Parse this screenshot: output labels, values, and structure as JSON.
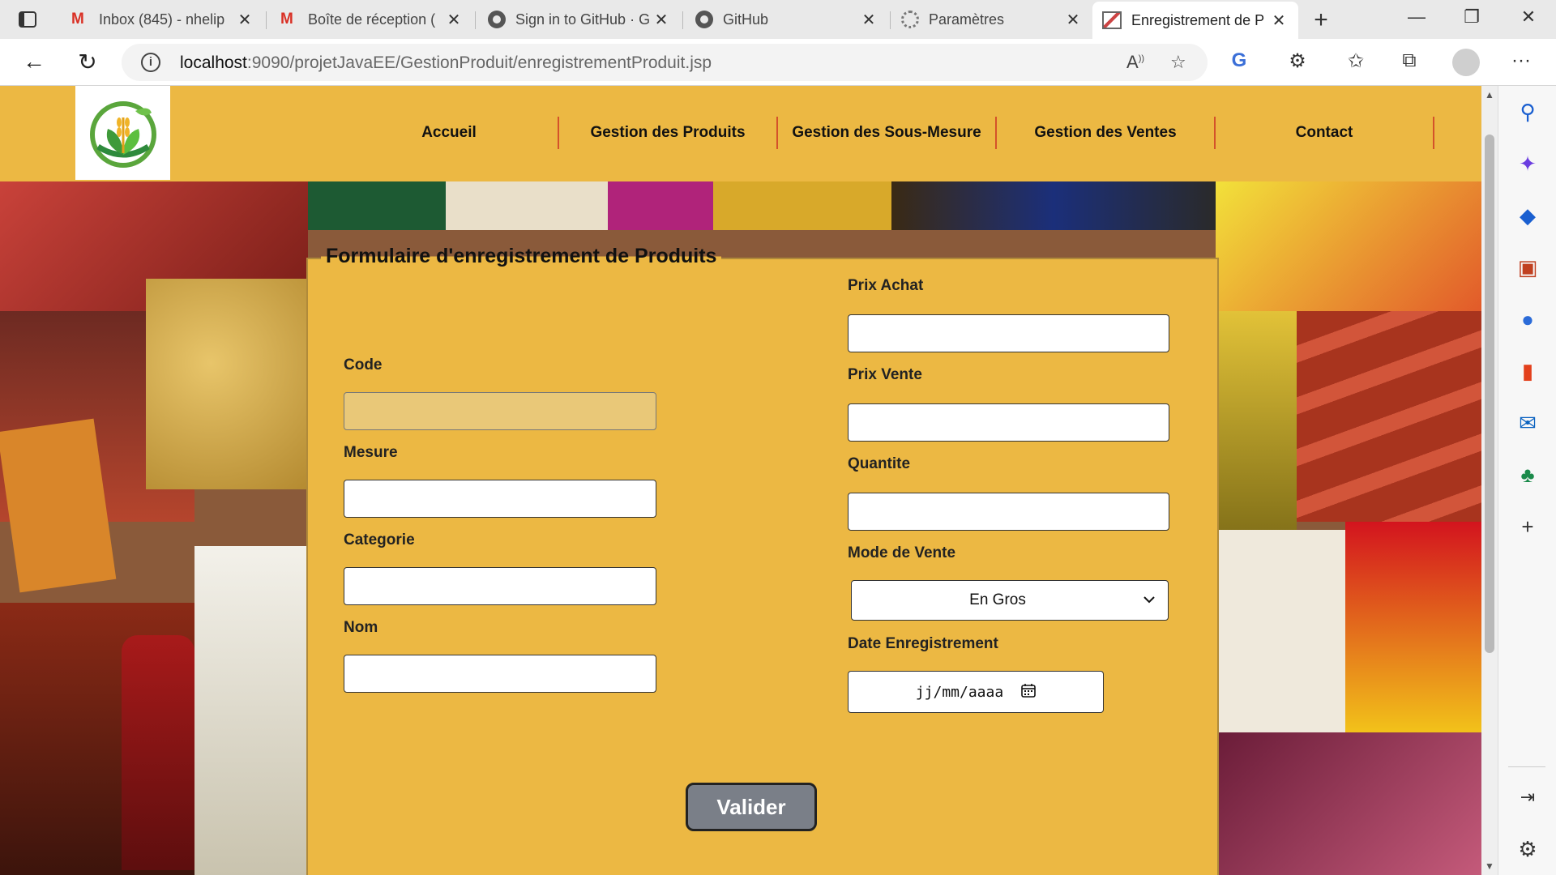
{
  "browser": {
    "tabs": [
      {
        "title": "Inbox (845) - nhelip",
        "icon": "gmail-icon"
      },
      {
        "title": "Boîte de réception (",
        "icon": "gmail-icon"
      },
      {
        "title": "Sign in to GitHub · G",
        "icon": "github-icon"
      },
      {
        "title": "GitHub",
        "icon": "github-icon"
      },
      {
        "title": "Paramètres",
        "icon": "settings-icon"
      },
      {
        "title": "Enregistrement de P",
        "icon": "page-icon"
      }
    ],
    "url_host": "localhost",
    "url_path": ":9090/projetJavaEE/GestionProduit/enregistrementProduit.jsp"
  },
  "site": {
    "nav": [
      "Accueil",
      "Gestion des Produits",
      "Gestion des Sous-Mesure",
      "Gestion des Ventes",
      "Contact"
    ]
  },
  "form": {
    "legend": "Formulaire d'enregistrement de Produits",
    "labels": {
      "code": "Code",
      "mesure": "Mesure",
      "categorie": "Categorie",
      "nom": "Nom",
      "prix_achat": "Prix Achat",
      "prix_vente": "Prix Vente",
      "quantite": "Quantite",
      "mode_vente": "Mode de Vente",
      "date_enregistrement": "Date Enregistrement"
    },
    "values": {
      "code": "",
      "mesure": "",
      "categorie": "",
      "nom": "",
      "prix_achat": "",
      "prix_vente": "",
      "quantite": ""
    },
    "mode_vente_selected": "En Gros",
    "date_placeholder": "jj/mm/aaaa",
    "submit_label": "Valider"
  },
  "colors": {
    "header_bg": "#ecb843",
    "nav_separator": "#d4522a",
    "submit_bg": "#7a7f88"
  }
}
